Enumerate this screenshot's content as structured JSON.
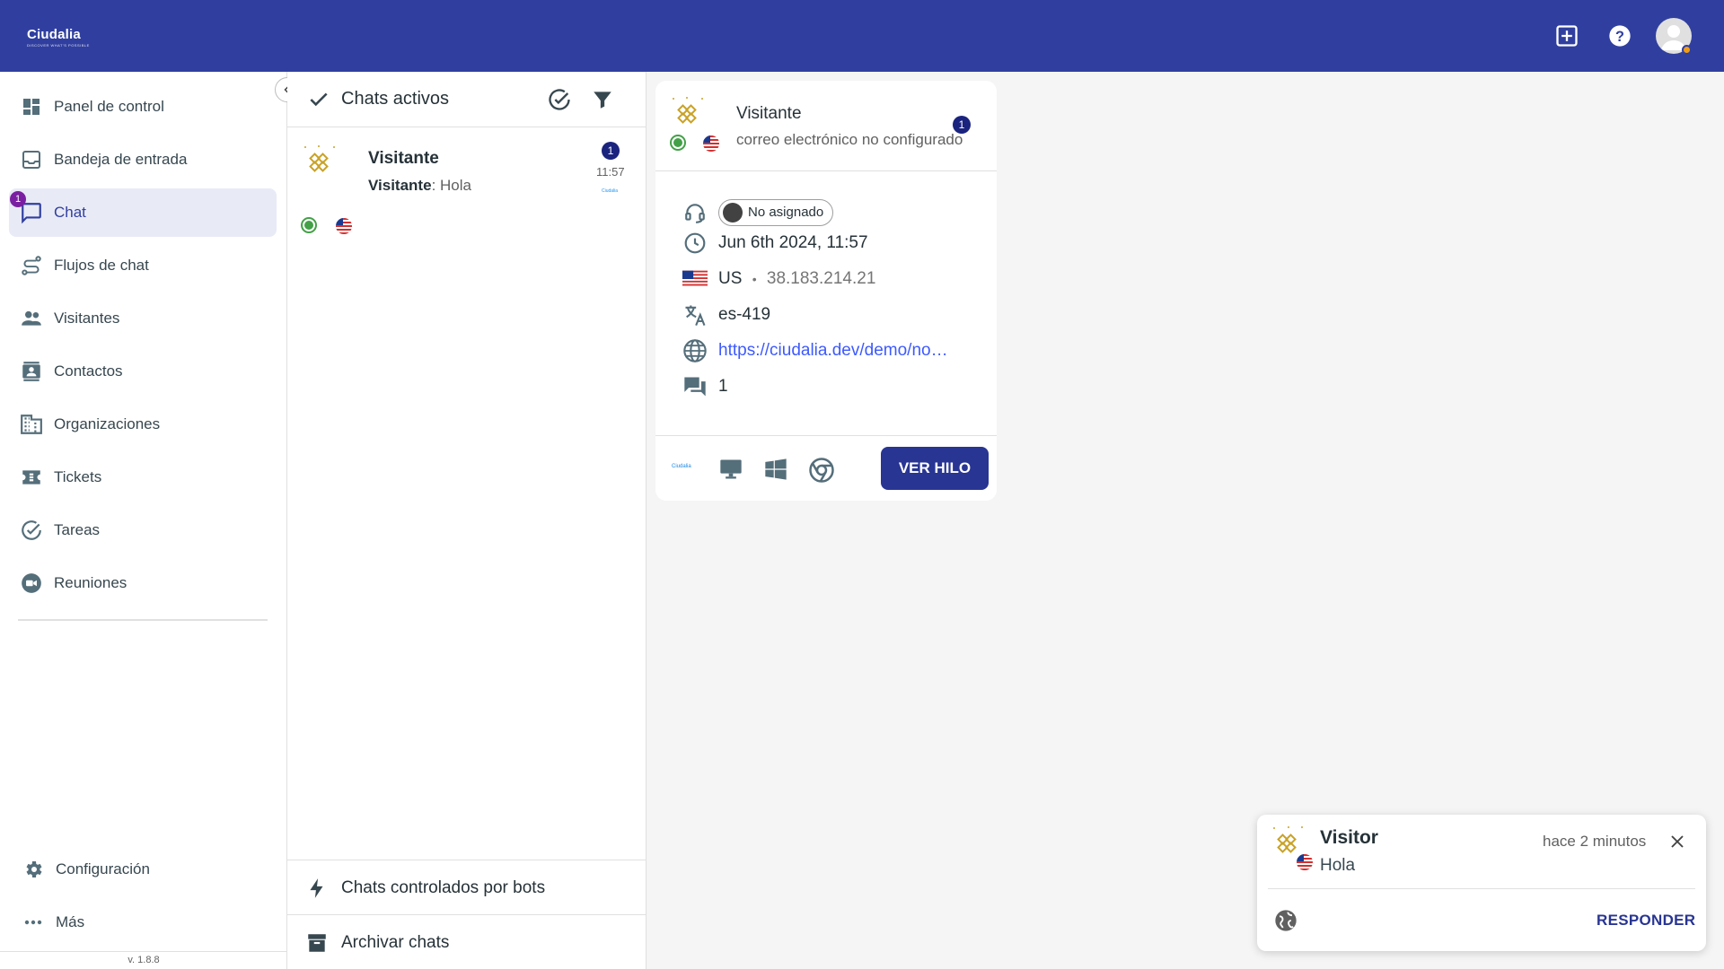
{
  "header": {
    "logo_text": "Ciudalia",
    "logo_tagline": "DISCOVER WHAT'S POSSIBLE",
    "icons": [
      "add-box-icon",
      "help-icon",
      "account-icon"
    ],
    "avatar_status_color": "#f39c12",
    "brand_color": "#303f9f"
  },
  "sidebar": {
    "items": [
      {
        "label": "Panel de control",
        "icon": "dashboard-icon"
      },
      {
        "label": "Bandeja de entrada",
        "icon": "inbox-icon"
      },
      {
        "label": "Chat",
        "icon": "chat-icon",
        "active": true,
        "badge": "1"
      },
      {
        "label": "Flujos de chat",
        "icon": "flow-icon"
      },
      {
        "label": "Visitantes",
        "icon": "people-icon"
      },
      {
        "label": "Contactos",
        "icon": "contacts-icon"
      },
      {
        "label": "Organizaciones",
        "icon": "building-icon"
      },
      {
        "label": "Tickets",
        "icon": "ticket-icon"
      },
      {
        "label": "Tareas",
        "icon": "task-icon"
      },
      {
        "label": "Reuniones",
        "icon": "video-icon"
      }
    ],
    "bottom_items": [
      {
        "label": "Configuración",
        "icon": "gear-icon"
      },
      {
        "label": "Más",
        "icon": "more-icon"
      }
    ],
    "version": "v. 1.8.8"
  },
  "chat_list": {
    "title": "Chats activos",
    "items": [
      {
        "name": "Visitante",
        "sender": "Visitante",
        "message": ": Hola",
        "time": "11:57",
        "unread": "1",
        "site_logo": "Ciudalia"
      }
    ],
    "footer": {
      "bots_label": "Chats controlados por bots",
      "archive_label": "Archivar chats"
    }
  },
  "visitor_card": {
    "name": "Visitante",
    "email": "correo electrónico no configurado",
    "unread": "1",
    "assignee": "No asignado",
    "datetime": "Jun 6th 2024, 11:57",
    "country": "US",
    "separator": "•",
    "ip": "38.183.214.21",
    "language": "es-419",
    "url": "https://ciudalia.dev/demo/no…",
    "chats_count": "1",
    "footer_logo": "Ciudalia",
    "view_button": "VER HILO"
  },
  "toast": {
    "name": "Visitor",
    "message": "Hola",
    "time": "hace 2 minutos",
    "reply_label": "RESPONDER"
  }
}
